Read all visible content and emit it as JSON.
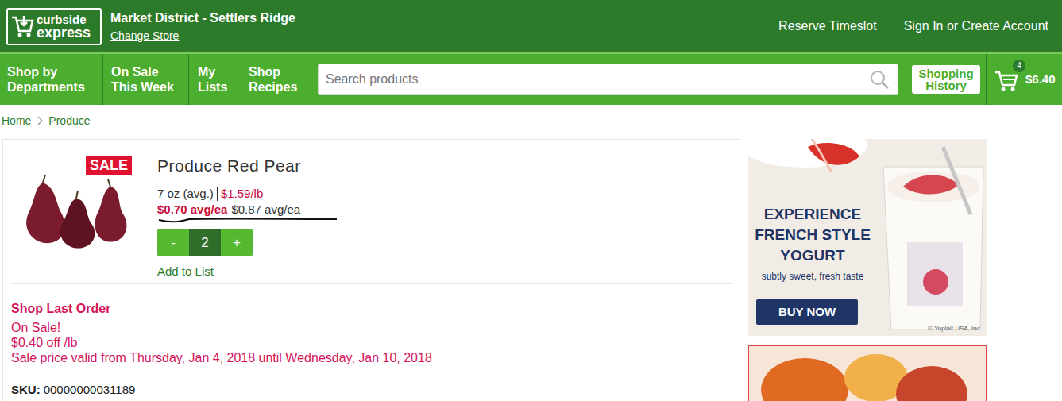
{
  "header": {
    "logo": {
      "line1": "curbside",
      "line2": "express"
    },
    "store": {
      "name": "Market District - Settlers Ridge",
      "change": "Change Store"
    },
    "links": [
      "Reserve Timeslot",
      "Sign In or Create Account"
    ]
  },
  "nav": {
    "items": [
      {
        "lines": [
          "Shop by",
          "Departments"
        ]
      },
      {
        "lines": [
          "On Sale",
          "This Week"
        ]
      },
      {
        "lines": [
          "My",
          "Lists"
        ]
      },
      {
        "lines": [
          "Shop",
          "Recipes"
        ]
      }
    ],
    "search": {
      "placeholder": "Search products"
    },
    "history": {
      "lines": [
        "Shopping",
        "History"
      ]
    },
    "cart": {
      "count": "4",
      "total": "$6.40"
    }
  },
  "breadcrumb": [
    "Home",
    "Produce"
  ],
  "product": {
    "badge": "SALE",
    "title": "Produce Red Pear",
    "size": "7 oz (avg.)",
    "unit_price": "$1.59/lb",
    "sale_price": "$0.70 avg/ea",
    "regular_price": "$0.87 avg/ea",
    "quantity": {
      "minus": "-",
      "value": "2",
      "plus": "+"
    },
    "add_to_list": "Add to List"
  },
  "promo": {
    "title": "Shop Last Order",
    "lines": [
      "On Sale!",
      "$0.40 off /lb",
      "Sale price valid from Thursday, Jan 4, 2018 until Wednesday, Jan 10, 2018"
    ]
  },
  "sku": {
    "label": "SKU:",
    "value": "00000000031189"
  },
  "ads": {
    "yogurt": {
      "headline": [
        "EXPERIENCE",
        "FRENCH STYLE",
        "YOGURT"
      ],
      "tagline": "subtly sweet, fresh taste",
      "button": "BUY NOW",
      "copyright": "© Yoplait USA, Inc."
    }
  }
}
